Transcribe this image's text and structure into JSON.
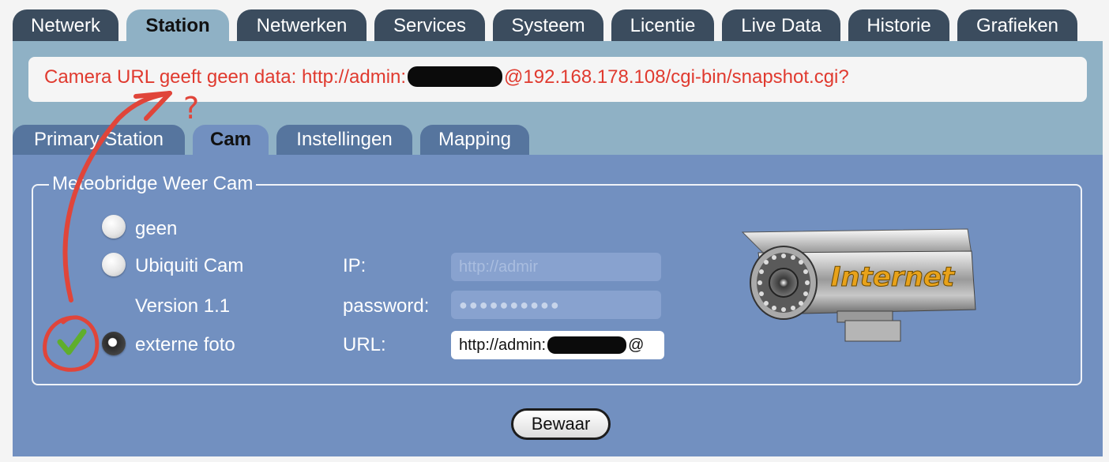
{
  "top_tabs": [
    {
      "label": "Netwerk",
      "active": false
    },
    {
      "label": "Station",
      "active": true
    },
    {
      "label": "Netwerken",
      "active": false
    },
    {
      "label": "Services",
      "active": false
    },
    {
      "label": "Systeem",
      "active": false
    },
    {
      "label": "Licentie",
      "active": false
    },
    {
      "label": "Live Data",
      "active": false
    },
    {
      "label": "Historie",
      "active": false
    },
    {
      "label": "Grafieken",
      "active": false
    }
  ],
  "message": {
    "prefix": "Camera URL geeft geen data: http://admin:",
    "suffix": "@192.168.178.108/cgi-bin/snapshot.cgi?",
    "color": "#e03a2f"
  },
  "sub_tabs": [
    {
      "label": "Primary Station",
      "active": false
    },
    {
      "label": "Cam",
      "active": true
    },
    {
      "label": "Instellingen",
      "active": false
    },
    {
      "label": "Mapping",
      "active": false
    }
  ],
  "cam_section": {
    "legend": "Meteobridge Weer Cam",
    "options": [
      {
        "label": "geen",
        "selected": false
      },
      {
        "label": "Ubiquiti Cam",
        "selected": false
      },
      {
        "label": "externe foto",
        "selected": true
      }
    ],
    "version_text": "Version 1.1",
    "ip_label": "IP:",
    "ip_value": "http://admir",
    "password_label": "password:",
    "password_value": "●●●●●●●●●●",
    "url_label": "URL:",
    "url_prefix": "http://admin:",
    "url_suffix": "@",
    "camera_image_text": "Internet"
  },
  "save_button": "Bewaar",
  "annotation": {
    "question_mark": "?",
    "color": "#e0453a"
  }
}
